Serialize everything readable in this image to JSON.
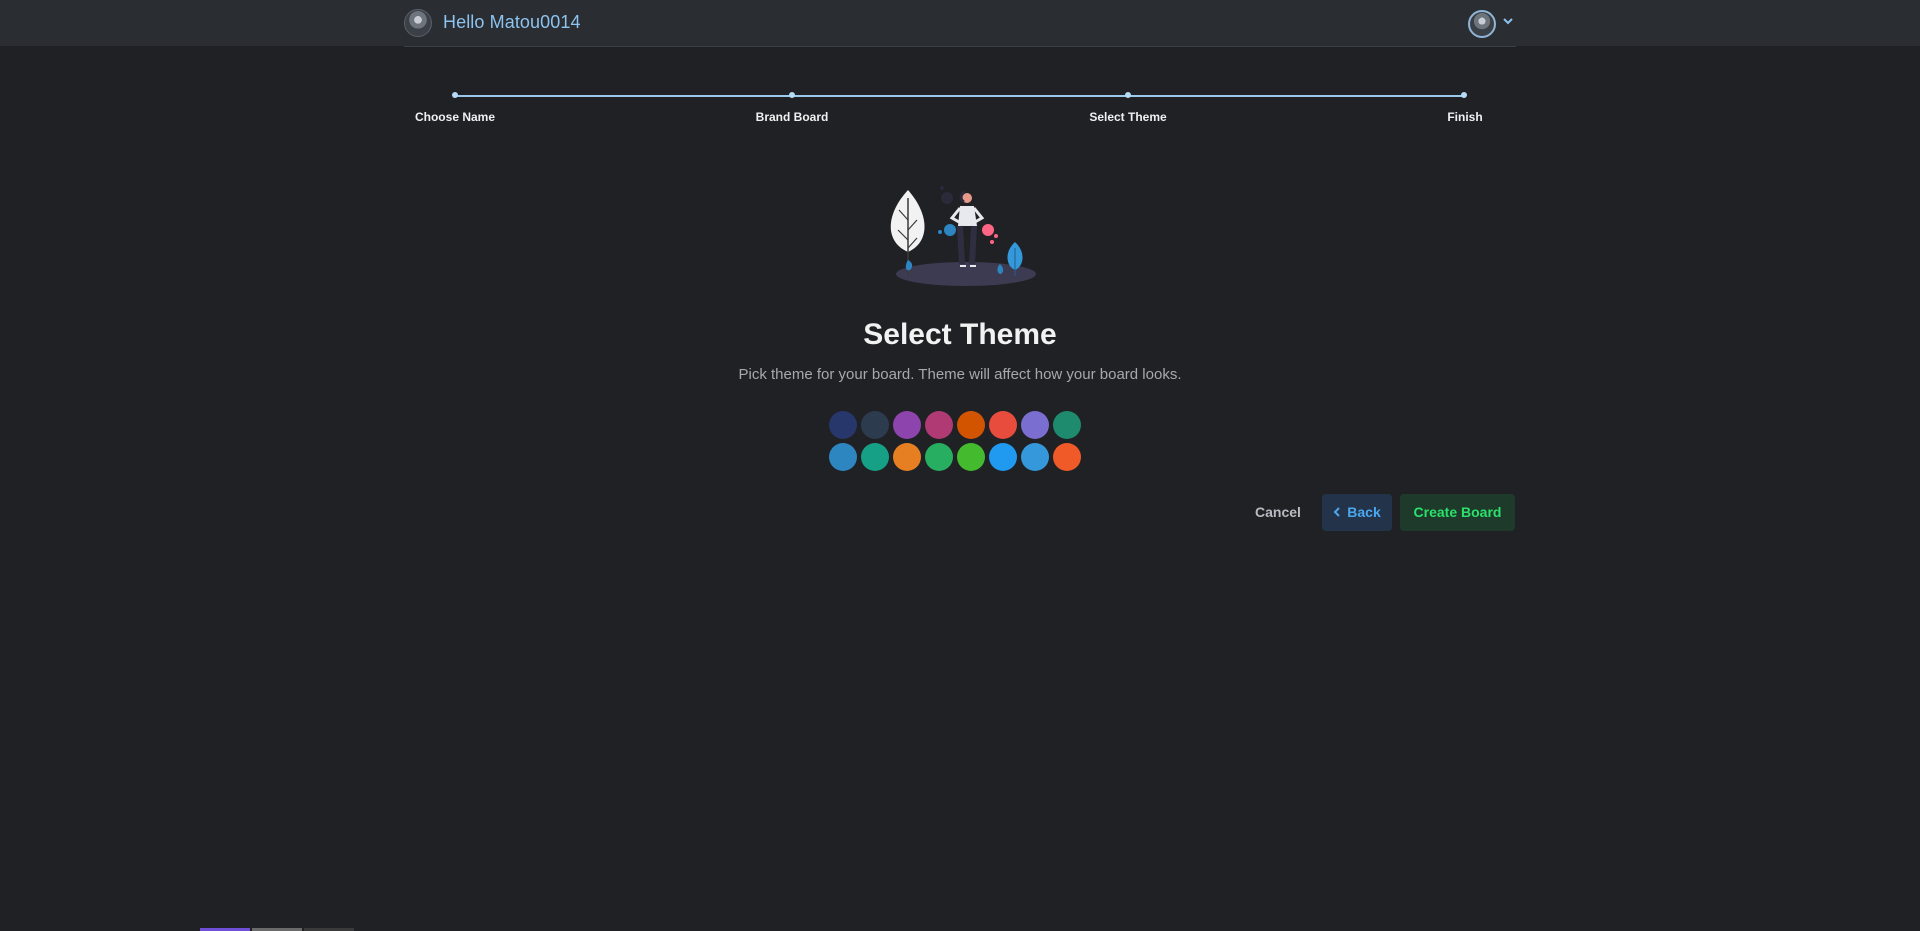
{
  "header": {
    "greeting": "Hello Matou0014",
    "left_avatar_icon": "user-avatar-icon",
    "right_avatar_icon": "user-avatar-icon",
    "menu_icon": "chevron-down-icon"
  },
  "stepper": {
    "steps": [
      {
        "label": "Choose Name"
      },
      {
        "label": "Brand Board"
      },
      {
        "label": "Select Theme"
      },
      {
        "label": "Finish"
      }
    ],
    "accent": "#9cc9ea"
  },
  "main": {
    "illustration": "person-with-plants-illustration",
    "title": "Select Theme",
    "subtitle": "Pick theme for your board. Theme will affect how your board looks."
  },
  "themes": {
    "colors": [
      "#27376b",
      "#2c3b4e",
      "#8e44ad",
      "#b03a74",
      "#d35400",
      "#e74c3c",
      "#7a6fd0",
      "#1e8a6e",
      "#2e86c1",
      "#16a085",
      "#e67e22",
      "#27ae60",
      "#44bb2f",
      "#1f9af0",
      "#3498db",
      "#f05a28"
    ]
  },
  "actions": {
    "cancel_label": "Cancel",
    "back_label": "Back",
    "back_icon": "chevron-left-icon",
    "create_label": "Create Board"
  }
}
